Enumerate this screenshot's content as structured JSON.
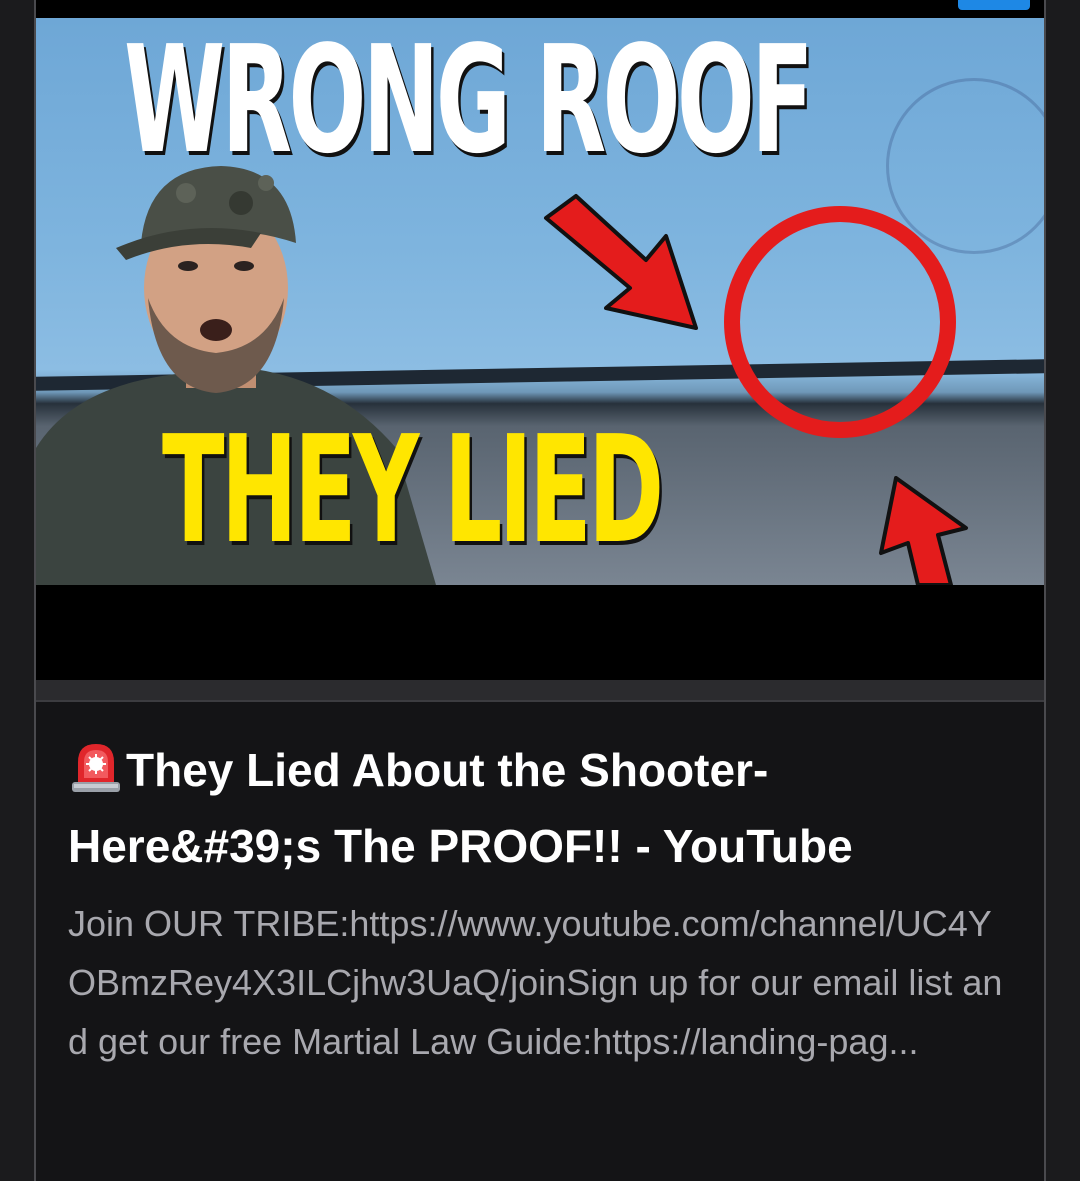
{
  "thumbnail": {
    "headline_top": "WRONG ROOF",
    "headline_bottom": "THEY LIED"
  },
  "link_preview": {
    "title_icon": "siren-icon",
    "title": "They Lied About the Shooter-Here&#39;s The PROOF!! - YouTube",
    "description": "Join OUR TRIBE:https://www.youtube.com/channel/UC4YOBmzRey4X3ILCjhw3UaQ/joinSign up for our email list and get our free Martial Law Guide:https://landing-pag..."
  },
  "colors": {
    "background": "#1b1b1d",
    "card": "#141416",
    "title_text": "#ffffff",
    "description_text": "#a8a8ae",
    "headline_yellow": "#ffe600",
    "arrow_red": "#e41c1c",
    "accent_blue": "#1e88e5"
  }
}
